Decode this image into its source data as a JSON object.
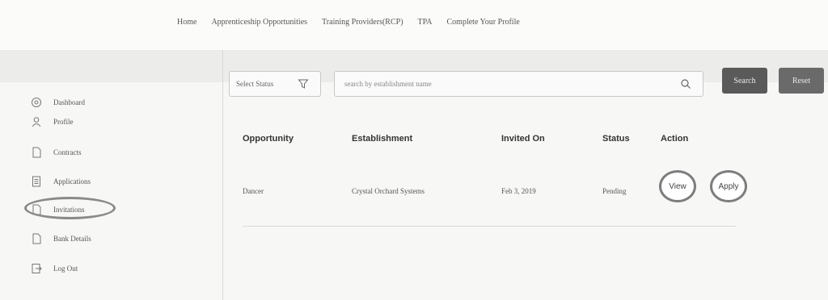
{
  "topnav": {
    "items": [
      "Home",
      "Apprenticeship Opportunities",
      "Training Providers(RCP)",
      "TPA",
      "Complete Your Profile"
    ]
  },
  "sidebar": {
    "items": [
      {
        "label": "Dashboard",
        "icon": "dashboard-icon"
      },
      {
        "label": "Profile",
        "icon": "user-icon"
      },
      {
        "label": "Contracts",
        "icon": "document-icon"
      },
      {
        "label": "Applications",
        "icon": "list-icon"
      },
      {
        "label": "Invitations",
        "icon": "document-icon"
      },
      {
        "label": "Bank Details",
        "icon": "document-icon"
      },
      {
        "label": "Log Out",
        "icon": "logout-icon"
      }
    ],
    "active": "Invitations"
  },
  "filters": {
    "status_placeholder": "Select Status",
    "search_placeholder": "search by establishment name",
    "search_label": "Search",
    "reset_label": "Reset"
  },
  "table": {
    "headers": [
      "Opportunity",
      "Establishment",
      "Invited On",
      "Status",
      "Action"
    ],
    "rows": [
      {
        "opportunity": "Dancer",
        "establishment": "Crystal Orchard Systems",
        "invited_on": "Feb 3, 2019",
        "status": "Pending",
        "actions": [
          "View",
          "Apply"
        ]
      }
    ]
  }
}
